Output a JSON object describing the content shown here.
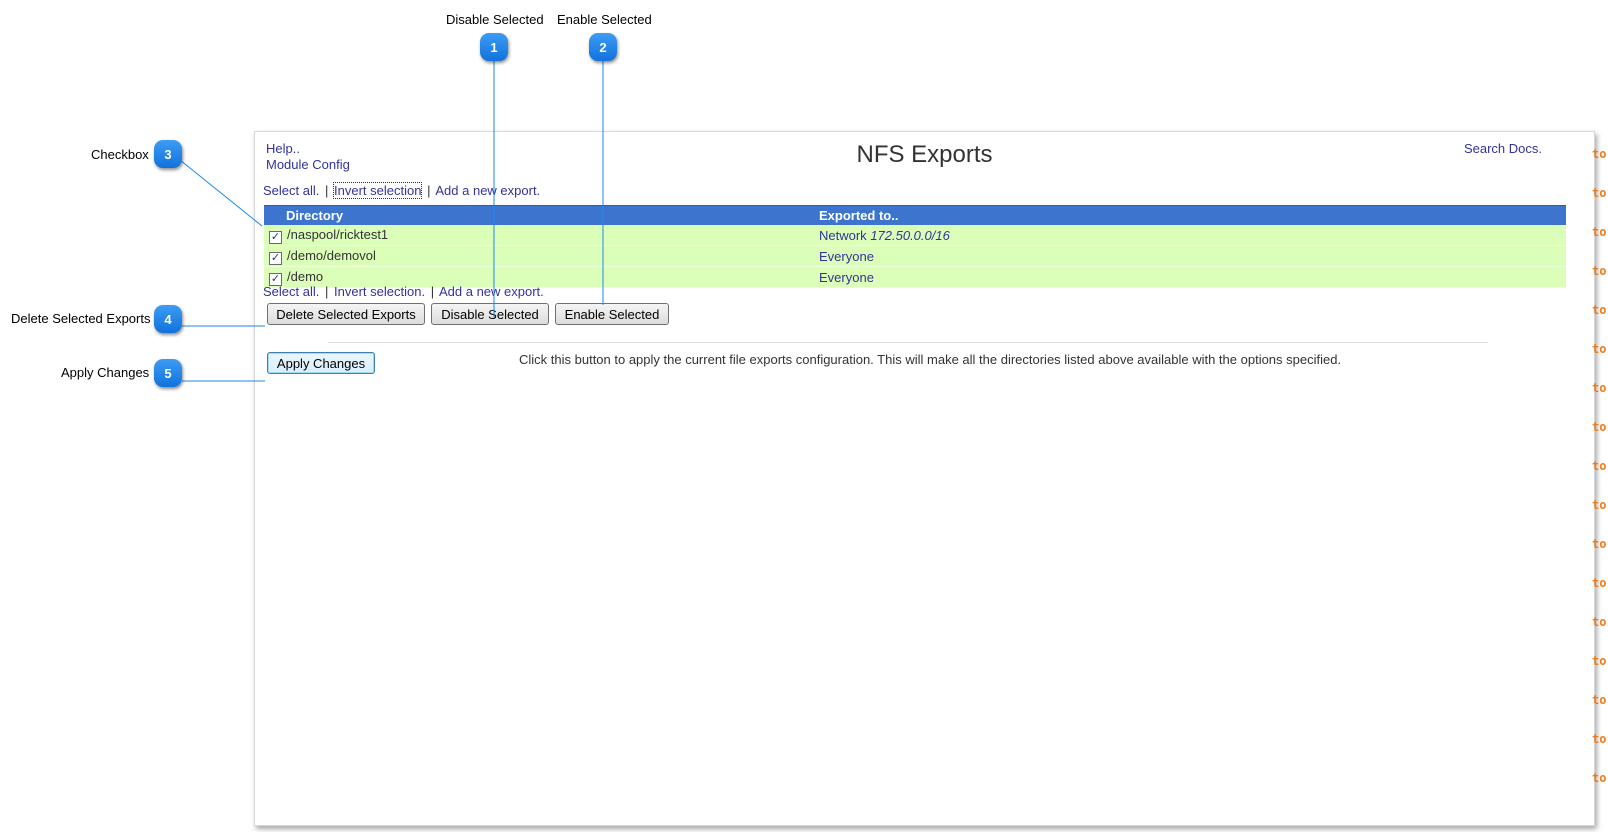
{
  "callouts": [
    {
      "num": "1",
      "label": "Disable Selected"
    },
    {
      "num": "2",
      "label": "Enable Selected"
    },
    {
      "num": "3",
      "label": "Checkbox"
    },
    {
      "num": "4",
      "label": "Delete Selected Exports"
    },
    {
      "num": "5",
      "label": "Apply Changes"
    }
  ],
  "header": {
    "help_link": "Help..",
    "module_config_link": "Module Config",
    "title": "NFS Exports",
    "search_docs_link": "Search Docs."
  },
  "selection_bar": {
    "select_all": "Select all.",
    "separator": "|",
    "invert_selection_top": "Invert selection",
    "invert_selection": "Invert selection.",
    "add_export": "Add a new export."
  },
  "table": {
    "columns": [
      "Directory",
      "Exported to.."
    ],
    "rows": [
      {
        "checked": true,
        "directory": "/naspool/ricktest1",
        "exported_prefix": "Network",
        "exported_value": "172.50.0.0/16"
      },
      {
        "checked": true,
        "directory": "/demo/demovol",
        "exported_prefix": "Everyone",
        "exported_value": ""
      },
      {
        "checked": true,
        "directory": "/demo",
        "exported_prefix": "Everyone",
        "exported_value": ""
      }
    ]
  },
  "buttons": {
    "delete_selected": "Delete Selected Exports",
    "disable_selected": "Disable Selected",
    "enable_selected": "Enable Selected",
    "apply_changes": "Apply Changes"
  },
  "apply_description": "Click this button to apply the current file exports configuration. This will make all the directories listed above available with the options specified.",
  "gutter_text": "to",
  "icons": {
    "checkbox": "check-mark-icon"
  },
  "colors": {
    "badge": "#1f87ea",
    "table_header": "#3d75ce",
    "row_bg": "#dbffb8",
    "link": "#333399",
    "gutter": "#f07b17"
  }
}
